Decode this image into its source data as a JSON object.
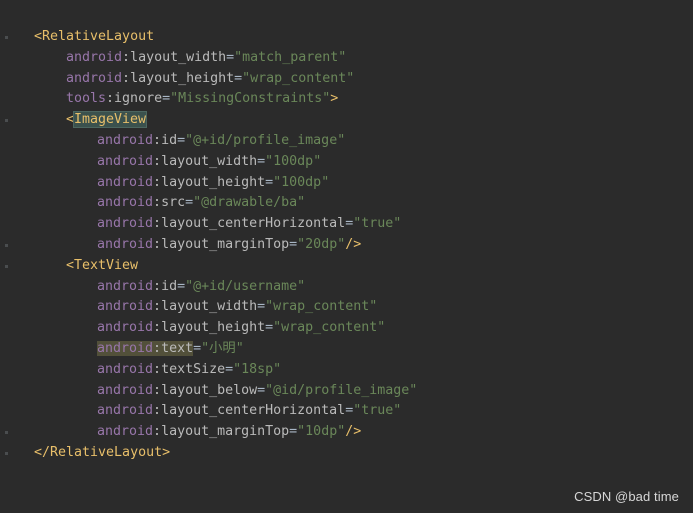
{
  "code_lines": [
    {
      "type": "open_tag_start",
      "indent": 0,
      "tag": "<RelativeLayout"
    },
    {
      "type": "attr",
      "indent": 1,
      "ns": "android",
      "name": "layout_width",
      "value": "\"match_parent\""
    },
    {
      "type": "attr",
      "indent": 1,
      "ns": "android",
      "name": "layout_height",
      "value": "\"wrap_content\""
    },
    {
      "type": "attr_end",
      "indent": 1,
      "ns": "tools",
      "name": "ignore",
      "value": "\"MissingConstraints\"",
      "end": ">"
    },
    {
      "type": "open_tag_start",
      "indent": 1,
      "tag": "ImageView",
      "highlight": true
    },
    {
      "type": "attr",
      "indent": 2,
      "ns": "android",
      "name": "id",
      "value": "\"@+id/profile_image\""
    },
    {
      "type": "attr",
      "indent": 2,
      "ns": "android",
      "name": "layout_width",
      "value": "\"100dp\""
    },
    {
      "type": "attr",
      "indent": 2,
      "ns": "android",
      "name": "layout_height",
      "value": "\"100dp\""
    },
    {
      "type": "attr",
      "indent": 2,
      "ns": "android",
      "name": "src",
      "value": "\"@drawable/ba\""
    },
    {
      "type": "attr",
      "indent": 2,
      "ns": "android",
      "name": "layout_centerHorizontal",
      "value": "\"true\""
    },
    {
      "type": "attr_end",
      "indent": 2,
      "ns": "android",
      "name": "layout_marginTop",
      "value": "\"20dp\"",
      "end": "/>"
    },
    {
      "type": "open_tag_start",
      "indent": 1,
      "tag": "<TextView"
    },
    {
      "type": "attr",
      "indent": 2,
      "ns": "android",
      "name": "id",
      "value": "\"@+id/username\""
    },
    {
      "type": "attr",
      "indent": 2,
      "ns": "android",
      "name": "layout_width",
      "value": "\"wrap_content\""
    },
    {
      "type": "attr",
      "indent": 2,
      "ns": "android",
      "name": "layout_height",
      "value": "\"wrap_content\""
    },
    {
      "type": "attr",
      "indent": 2,
      "ns": "android",
      "name": "text",
      "value": "\"小明\"",
      "highlight": true
    },
    {
      "type": "attr",
      "indent": 2,
      "ns": "android",
      "name": "textSize",
      "value": "\"18sp\""
    },
    {
      "type": "attr",
      "indent": 2,
      "ns": "android",
      "name": "layout_below",
      "value": "\"@id/profile_image\""
    },
    {
      "type": "attr",
      "indent": 2,
      "ns": "android",
      "name": "layout_centerHorizontal",
      "value": "\"true\""
    },
    {
      "type": "attr_end",
      "indent": 2,
      "ns": "android",
      "name": "layout_marginTop",
      "value": "\"10dp\"",
      "end": "/>"
    },
    {
      "type": "close_tag",
      "indent": 0,
      "tag": "</RelativeLayout>"
    }
  ],
  "watermark": "CSDN @bad time"
}
